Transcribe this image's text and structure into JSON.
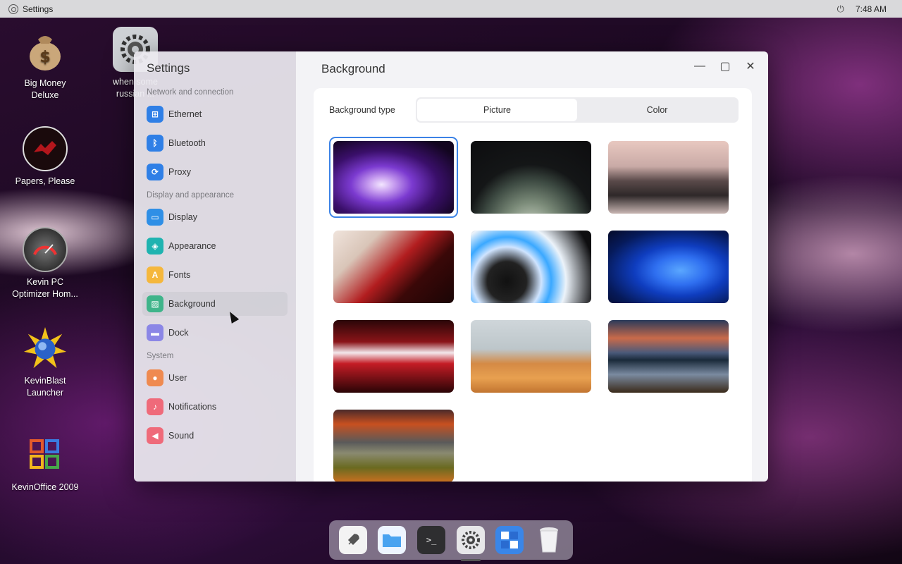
{
  "topbar": {
    "app_name": "Settings",
    "clock": "7:48 AM",
    "power_icon": "power-icon"
  },
  "desktop": {
    "icons": [
      {
        "label_line1": "Big Money",
        "label_line2": "Deluxe",
        "icon": "money-bag-icon"
      },
      {
        "label_line1": "when some",
        "label_line2": "russian ...",
        "icon": "gear-icon"
      },
      {
        "label_line1": "Papers, Please",
        "label_line2": "",
        "icon": "papers-please-icon"
      },
      {
        "label_line1": "Kevin PC",
        "label_line2": "Optimizer Hom...",
        "icon": "speedometer-icon"
      },
      {
        "label_line1": "KevinBlast",
        "label_line2": "Launcher",
        "icon": "starburst-icon"
      },
      {
        "label_line1": "KevinOffice 2009",
        "label_line2": "",
        "icon": "office-icon"
      }
    ]
  },
  "settings": {
    "sidebar_title": "Settings",
    "sections": [
      {
        "title": "Network and connection",
        "items": [
          {
            "label": "Ethernet",
            "icon": "ethernet-icon",
            "color": "#2f7fe6"
          },
          {
            "label": "Bluetooth",
            "icon": "bluetooth-icon",
            "color": "#2f7fe6"
          },
          {
            "label": "Proxy",
            "icon": "proxy-icon",
            "color": "#2f7fe6"
          }
        ]
      },
      {
        "title": "Display and appearance",
        "items": [
          {
            "label": "Display",
            "icon": "display-icon",
            "color": "#2f8fe6"
          },
          {
            "label": "Appearance",
            "icon": "appearance-icon",
            "color": "#1fb3b0"
          },
          {
            "label": "Fonts",
            "icon": "fonts-icon",
            "color": "#f5b73c"
          },
          {
            "label": "Background",
            "icon": "background-icon",
            "color": "#3fb48a",
            "active": true
          },
          {
            "label": "Dock",
            "icon": "dock-icon",
            "color": "#8b86e6"
          }
        ]
      },
      {
        "title": "System",
        "items": [
          {
            "label": "User",
            "icon": "user-icon",
            "color": "#ef8a50"
          },
          {
            "label": "Notifications",
            "icon": "bell-icon",
            "color": "#ef6a7a"
          },
          {
            "label": "Sound",
            "icon": "sound-icon",
            "color": "#ef6a7a"
          }
        ]
      }
    ],
    "page_title": "Background",
    "background_type_label": "Background type",
    "segments": {
      "picture": "Picture",
      "color": "Color",
      "selected": "picture"
    },
    "selected_wallpaper_index": 0,
    "window_controls": {
      "minimize": "minimize-icon",
      "maximize": "maximize-icon",
      "close": "close-icon"
    }
  },
  "dock": {
    "items": [
      {
        "name": "launcher",
        "icon": "rocket-icon"
      },
      {
        "name": "files",
        "icon": "folder-icon"
      },
      {
        "name": "terminal",
        "icon": "terminal-icon"
      },
      {
        "name": "settings",
        "icon": "gear-icon",
        "running": true
      },
      {
        "name": "calculator",
        "icon": "calculator-icon"
      },
      {
        "name": "trash",
        "icon": "trash-icon"
      }
    ]
  }
}
